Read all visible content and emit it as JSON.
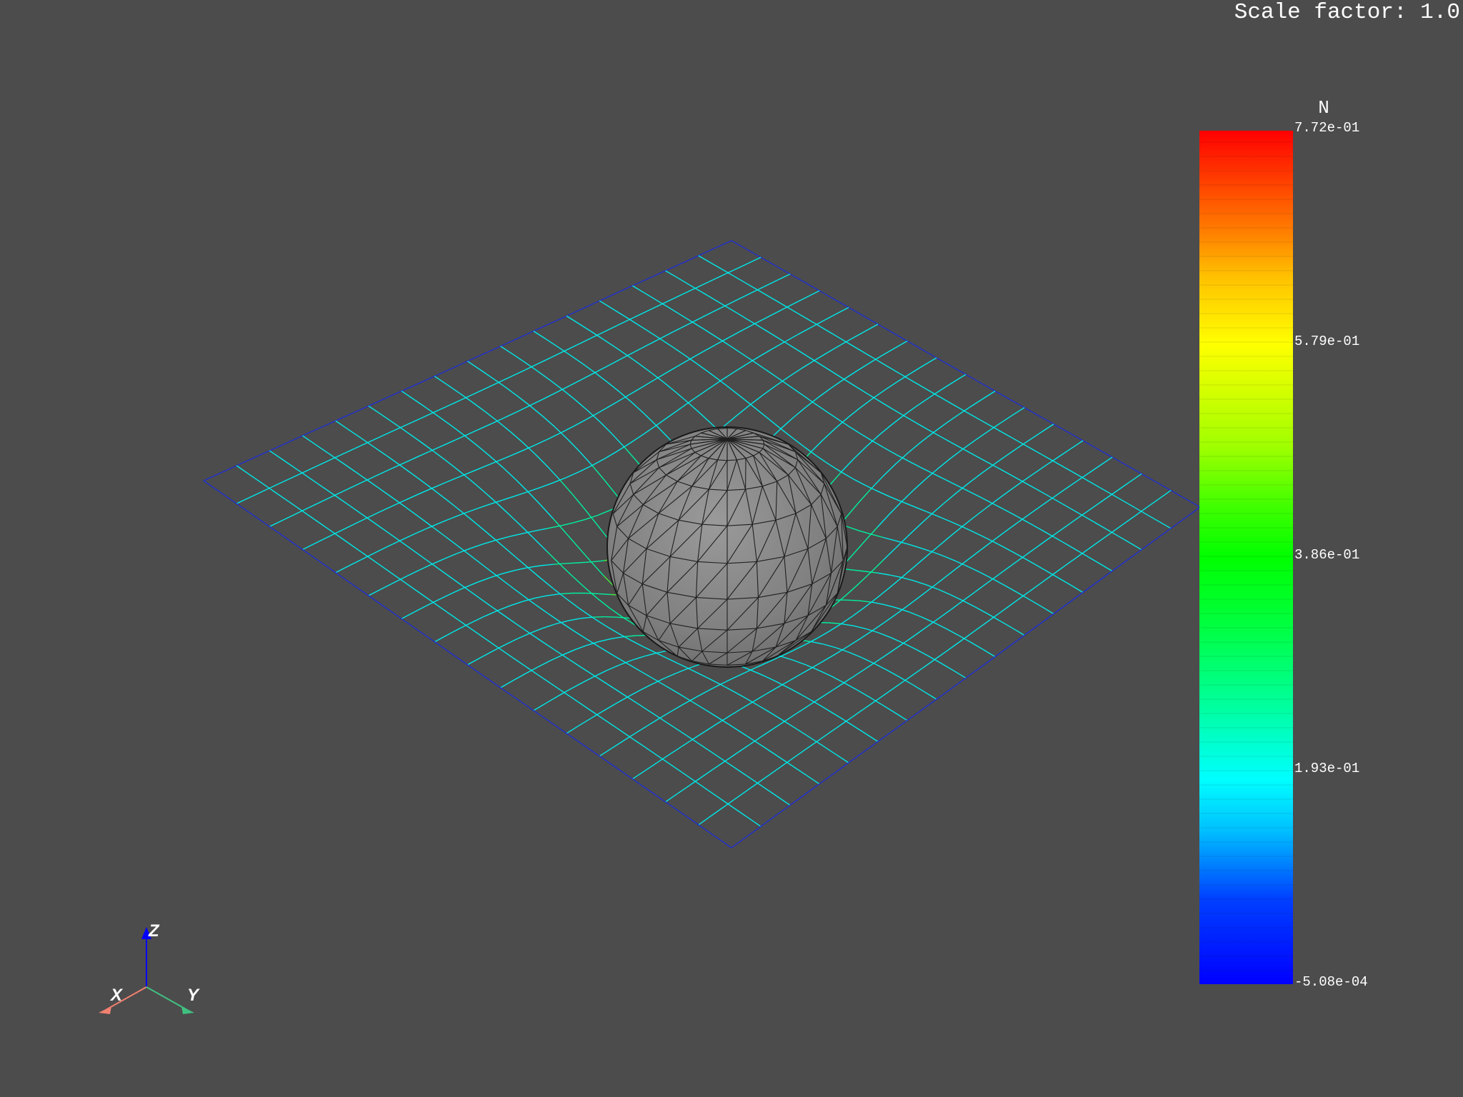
{
  "overlay": {
    "scale_factor_text": "Scale factor: 1.0"
  },
  "colorbar": {
    "title": "N",
    "ticks": [
      "7.72e-01",
      "5.79e-01",
      "3.86e-01",
      "1.93e-01",
      "-5.08e-04"
    ],
    "max": 0.772,
    "min": -0.000508,
    "colormap": "jet",
    "colors": [
      "#0000ff",
      "#00ffff",
      "#00ff00",
      "#ffff00",
      "#ff0000"
    ]
  },
  "scene": {
    "objects": [
      "deformed-wireframe-membrane",
      "sphere-mesh"
    ],
    "sphere_color": "#808080",
    "background_color": "#4c4c4c"
  },
  "axes_widget": {
    "labels": {
      "x": "X",
      "y": "Y",
      "z": "Z"
    },
    "colors": {
      "x": "#f08070",
      "y": "#40c080",
      "z": "#0000ff"
    }
  }
}
